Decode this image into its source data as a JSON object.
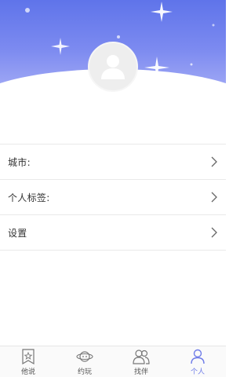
{
  "profile": {
    "avatar_icon": "user-placeholder-icon"
  },
  "list": {
    "items": [
      {
        "label": "城市:",
        "icon": "chevron-right-icon"
      },
      {
        "label": "个人标签:",
        "icon": "chevron-right-icon"
      },
      {
        "label": "设置",
        "icon": "chevron-right-icon"
      }
    ]
  },
  "tabbar": {
    "tabs": [
      {
        "label": "他说",
        "icon": "bookmark-star-icon",
        "active": false
      },
      {
        "label": "约玩",
        "icon": "planet-chat-icon",
        "active": false
      },
      {
        "label": "找伴",
        "icon": "people-icon",
        "active": false
      },
      {
        "label": "个人",
        "icon": "person-icon",
        "active": true
      }
    ],
    "active_color": "#6f7ce8",
    "inactive_color": "#777777"
  },
  "theme": {
    "header_top": "#5f74ea",
    "header_bottom": "#a9b0f6"
  }
}
